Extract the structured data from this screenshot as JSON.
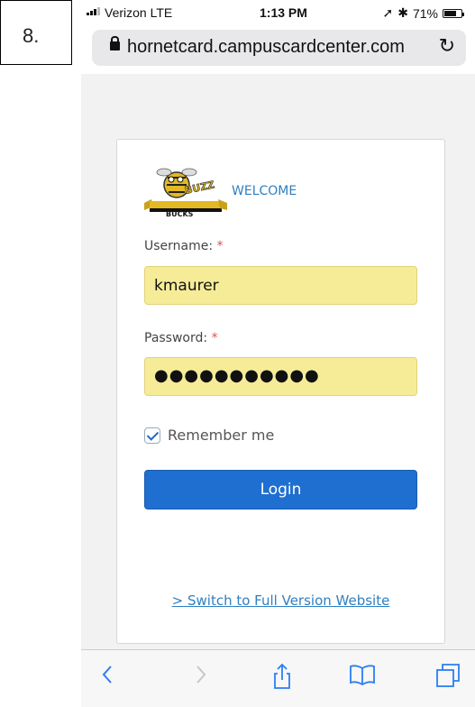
{
  "step_label": "8.",
  "status_bar": {
    "carrier": "Verizon  LTE",
    "time": "1:13 PM",
    "battery": "71%",
    "battery_level": 0.71
  },
  "browser": {
    "url": "hornetcard.campuscardcenter.com"
  },
  "login_card": {
    "logo_text": "BUZZ",
    "logo_subtext": "BUCKS",
    "welcome": "WELCOME",
    "username_label": "Username:",
    "username_value": "kmaurer",
    "password_label": "Password:",
    "password_value": "●●●●●●●●●●●",
    "required_marker": "*",
    "remember_label": "Remember me",
    "remember_checked": true,
    "login_button": "Login",
    "switch_link": "> Switch to Full Version Website"
  },
  "toolbar_icons": [
    "back-arrow-icon",
    "forward-arrow-icon",
    "share-icon",
    "bookmarks-icon",
    "tabs-icon"
  ],
  "colors": {
    "accent_blue": "#1f6fd1",
    "link_blue": "#2f7fc1",
    "autofill_yellow": "#f6ec98",
    "required_red": "#d9534f"
  }
}
